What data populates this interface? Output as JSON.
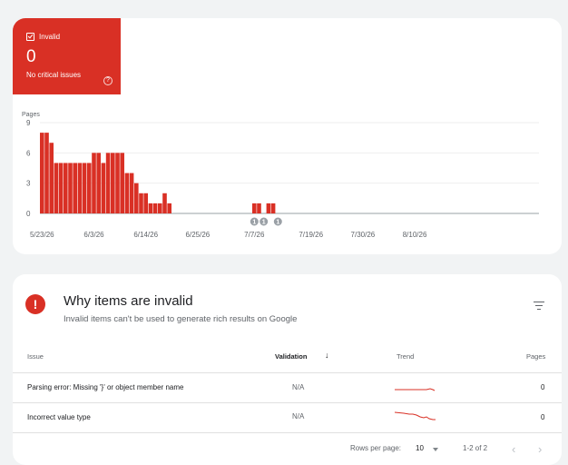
{
  "status_tile": {
    "label": "Invalid",
    "count": "0",
    "description": "No critical issues",
    "help_glyph": "?",
    "color": "#d93025"
  },
  "chart_data": {
    "type": "bar",
    "ylabel": "Pages",
    "yticks": [
      "0",
      "3",
      "6",
      "9"
    ],
    "ylim": [
      0,
      9
    ],
    "grid": true,
    "bar_color": "#d93025",
    "x_tick_labels": [
      "5/23/26",
      "6/3/26",
      "6/14/26",
      "6/25/26",
      "7/7/26",
      "7/19/26",
      "7/30/26",
      "8/10/26"
    ],
    "categories": [
      "5/23/26",
      "5/24/26",
      "5/25/26",
      "5/26/26",
      "5/27/26",
      "5/28/26",
      "5/29/26",
      "5/30/26",
      "5/31/26",
      "6/1/26",
      "6/2/26",
      "6/3/26",
      "6/4/26",
      "6/5/26",
      "6/6/26",
      "6/7/26",
      "6/8/26",
      "6/9/26",
      "6/10/26",
      "6/11/26",
      "6/12/26",
      "6/13/26",
      "6/14/26",
      "6/15/26",
      "6/16/26",
      "6/17/26",
      "6/18/26",
      "6/19/26",
      "6/20/26",
      "6/21/26",
      "6/22/26",
      "6/23/26",
      "6/24/26",
      "6/25/26",
      "6/26/26",
      "6/27/26",
      "6/28/26",
      "6/29/26",
      "6/30/26",
      "7/1/26",
      "7/2/26",
      "7/3/26",
      "7/4/26",
      "7/5/26",
      "7/6/26",
      "7/7/26",
      "7/8/26",
      "7/9/26",
      "7/10/26",
      "7/11/26",
      "7/12/26",
      "7/13/26",
      "7/14/26",
      "7/15/26",
      "7/16/26",
      "7/17/26",
      "7/18/26",
      "7/19/26",
      "7/20/26",
      "7/21/26",
      "7/22/26",
      "7/23/26",
      "7/24/26",
      "7/25/26",
      "7/26/26",
      "7/27/26",
      "7/28/26",
      "7/29/26",
      "7/30/26",
      "7/31/26",
      "8/1/26",
      "8/2/26",
      "8/3/26",
      "8/4/26",
      "8/5/26",
      "8/6/26",
      "8/7/26",
      "8/8/26",
      "8/9/26",
      "8/10/26",
      "8/11/26",
      "8/12/26",
      "8/13/26",
      "8/14/26",
      "8/15/26",
      "8/16/26",
      "8/17/26",
      "8/18/26",
      "8/19/26"
    ],
    "values": [
      8,
      8,
      7,
      5,
      5,
      5,
      5,
      5,
      5,
      5,
      5,
      6,
      6,
      5,
      6,
      6,
      6,
      6,
      4,
      4,
      3,
      2,
      2,
      1,
      1,
      1,
      2,
      1,
      0,
      0,
      0,
      0,
      0,
      0,
      0,
      0,
      0,
      0,
      0,
      0,
      0,
      0,
      0,
      0,
      0,
      1,
      1,
      0,
      1,
      1,
      0,
      0,
      0,
      0,
      0,
      0,
      0,
      0,
      0,
      0,
      0,
      0,
      0,
      0,
      0,
      0,
      0,
      0,
      0,
      0,
      0,
      0,
      0,
      0,
      0,
      0,
      0,
      0,
      0,
      0,
      0,
      0,
      0,
      0,
      0,
      0,
      0,
      0,
      0
    ],
    "annotations": [
      {
        "date": "7/7/26",
        "label": "1"
      },
      {
        "date": "7/9/26",
        "label": "1"
      },
      {
        "date": "7/12/26",
        "label": "1"
      }
    ]
  },
  "issues": {
    "title": "Why items are invalid",
    "subtitle": "Invalid items can't be used to generate rich results on Google",
    "columns": {
      "issue": "Issue",
      "validation": "Validation",
      "trend": "Trend",
      "pages": "Pages"
    },
    "sort_glyph": "↓",
    "rows": [
      {
        "issue": "Parsing error: Missing '}' or object member name",
        "validation": "N/A",
        "pages": "0"
      },
      {
        "issue": "Incorrect value type",
        "validation": "N/A",
        "pages": "0"
      }
    ],
    "pagination": {
      "rows_per_page_label": "Rows per page:",
      "rows_per_page": "10",
      "range": "1-2 of 2",
      "prev_glyph": "‹",
      "next_glyph": "›"
    }
  }
}
